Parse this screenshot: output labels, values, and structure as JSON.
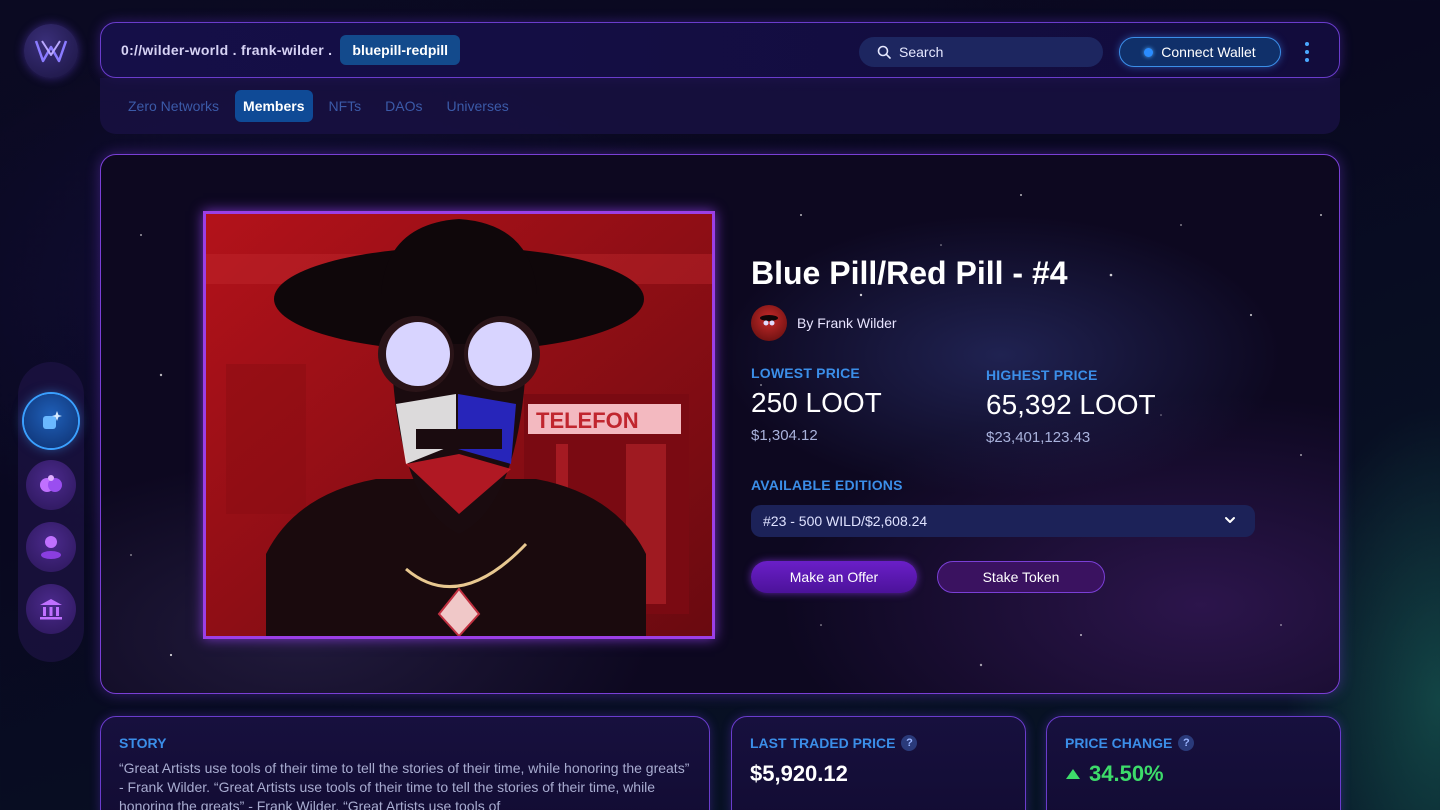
{
  "topbar": {
    "path": "0://wilder-world . frank-wilder .",
    "current": "bluepill-redpill",
    "search_label": "Search",
    "connect_label": "Connect Wallet"
  },
  "nav": {
    "tabs": [
      {
        "label": "Zero Networks",
        "active": false
      },
      {
        "label": "Members",
        "active": true
      },
      {
        "label": "NFTs",
        "active": false
      },
      {
        "label": "DAOs",
        "active": false
      },
      {
        "label": "Universes",
        "active": false
      }
    ]
  },
  "sidebar": {
    "items": [
      {
        "icon": "sparkle-cube-icon",
        "active": true
      },
      {
        "icon": "members-icon",
        "active": false
      },
      {
        "icon": "user-pedestal-icon",
        "active": false
      },
      {
        "icon": "bank-icon",
        "active": false
      }
    ]
  },
  "nft": {
    "title": "Blue Pill/Red Pill - #4",
    "creator": "By Frank Wilder",
    "art_sign_text": "TELEFON",
    "lowest": {
      "label": "LOWEST PRICE",
      "value": "250 LOOT",
      "usd": "$1,304.12"
    },
    "highest": {
      "label": "HIGHEST PRICE",
      "value": "65,392 LOOT",
      "usd": "$23,401,123.43"
    },
    "editions_label": "AVAILABLE EDITIONS",
    "editions_selected": "#23 - 500 WILD/$2,608.24",
    "offer_label": "Make an Offer",
    "stake_label": "Stake Token"
  },
  "story": {
    "title": "STORY",
    "text": "“Great Artists use tools of their time to tell the stories of their time, while honoring the greats” - Frank Wilder. “Great Artists use tools of their time to tell the stories of their time, while honoring the greats” - Frank Wilder. “Great Artists use tools of"
  },
  "last_traded": {
    "title": "LAST TRADED PRICE",
    "help": "?",
    "value": "$5,920.12"
  },
  "price_change": {
    "title": "PRICE CHANGE",
    "help": "?",
    "value": "34.50%",
    "color": "#3ddc6a"
  }
}
